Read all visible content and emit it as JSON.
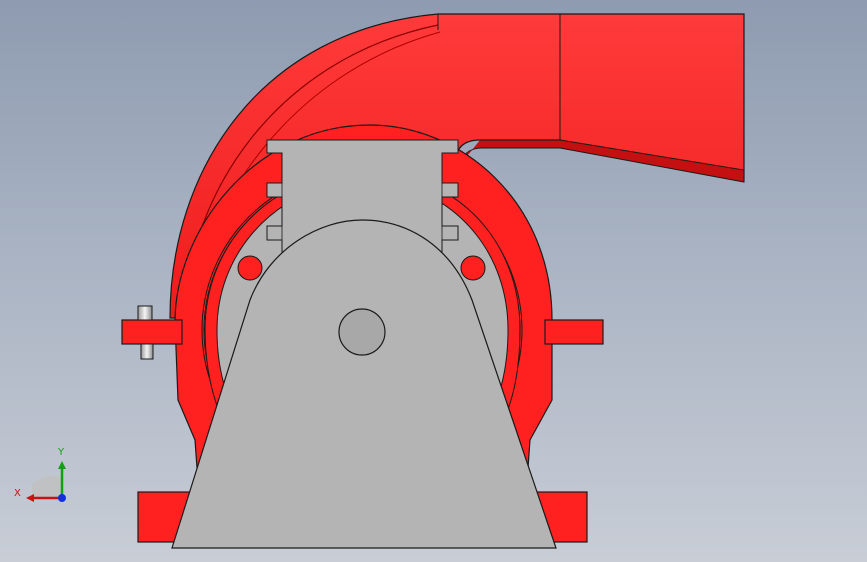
{
  "view": {
    "background_top": "#8e9bb0",
    "background_bottom": "#c8cdd6"
  },
  "model": {
    "body_color": "#ff2020",
    "frame_color": "#b4b4b4",
    "edge_color": "#1a1a1a"
  },
  "triad": {
    "x_label": "X",
    "y_label": "Y",
    "x_color": "#cc1010",
    "y_color": "#10a010",
    "z_color": "#1030e0"
  }
}
